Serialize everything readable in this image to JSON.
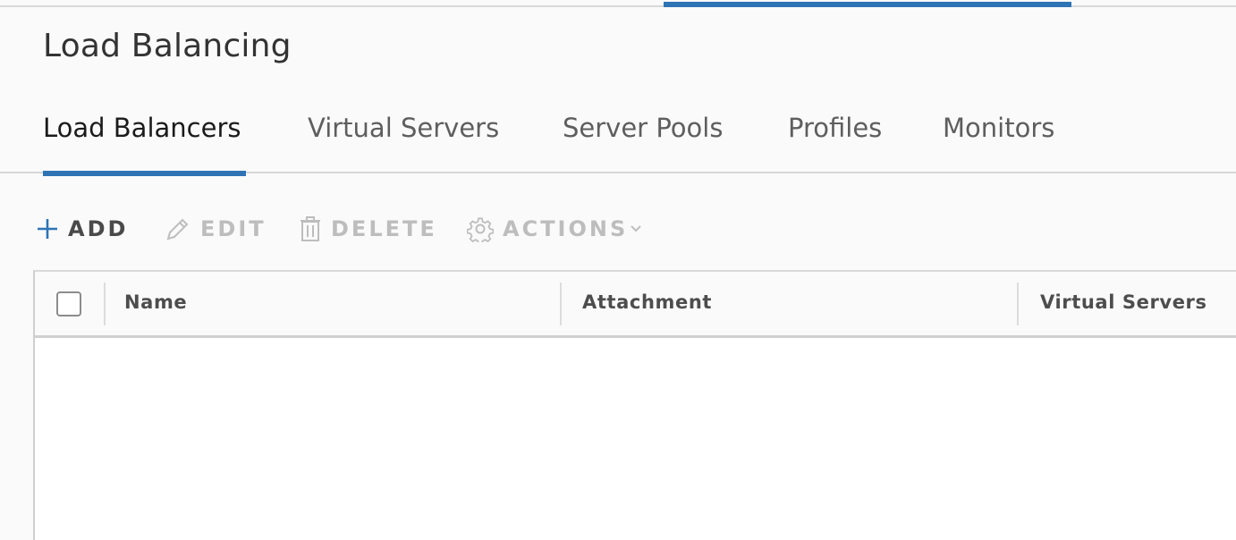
{
  "header": {
    "title": "Load Balancing"
  },
  "tabs": [
    {
      "label": "Load Balancers",
      "active": true
    },
    {
      "label": "Virtual Servers",
      "active": false
    },
    {
      "label": "Server Pools",
      "active": false
    },
    {
      "label": "Profiles",
      "active": false
    },
    {
      "label": "Monitors",
      "active": false
    }
  ],
  "toolbar": {
    "add_label": "ADD",
    "edit_label": "EDIT",
    "delete_label": "DELETE",
    "actions_label": "ACTIONS",
    "add_icon": "plus-icon",
    "edit_icon": "pencil-icon",
    "delete_icon": "trash-icon",
    "actions_icon": "gear-icon"
  },
  "grid": {
    "columns": [
      "Name",
      "Attachment",
      "Virtual Servers"
    ],
    "rows": []
  },
  "colors": {
    "accent": "#2e74b5",
    "disabled_text": "#bdbdbd"
  }
}
